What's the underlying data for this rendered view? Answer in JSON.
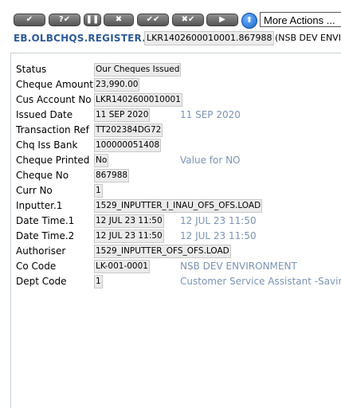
{
  "toolbar": {
    "buttons": [
      {
        "icon": "commit-tick-icon",
        "symbol": "✔"
      },
      {
        "icon": "validate-icon",
        "symbol": "?✔"
      },
      {
        "icon": "hold-icon",
        "symbol": "❚❚"
      },
      {
        "icon": "delete-icon",
        "symbol": "✖"
      },
      {
        "icon": "authorise-icon",
        "symbol": "✔✔"
      },
      {
        "icon": "reverse-icon",
        "symbol": "✖✔"
      },
      {
        "icon": "next-icon",
        "symbol": "▶"
      }
    ],
    "up_symbol": "⬆",
    "more_actions": "More Actions ..."
  },
  "header": {
    "app_title": "EB.OLBCHQS.REGISTER.NSB",
    "record_id": "LKR1402600010001.867988",
    "company": "(NSB DEV ENVI"
  },
  "fields": [
    {
      "label": "Status",
      "value": "Our Cheques Issued",
      "enrichment": ""
    },
    {
      "label": "Cheque Amount",
      "value": "23,990.00",
      "enrichment": ""
    },
    {
      "label": "Cus Account No",
      "value": "LKR1402600010001",
      "enrichment": ""
    },
    {
      "label": "Issued Date",
      "value": "11 SEP 2020",
      "enrichment": "11 SEP 2020"
    },
    {
      "label": "Transaction Ref",
      "value": "TT202384DG72",
      "enrichment": ""
    },
    {
      "label": "Chq Iss Bank",
      "value": "100000051408",
      "enrichment": ""
    },
    {
      "label": "Cheque Printed",
      "value": "No",
      "enrichment": "Value for NO"
    },
    {
      "label": "Cheque No",
      "value": "867988",
      "enrichment": ""
    },
    {
      "label": "Curr No",
      "value": "1",
      "enrichment": ""
    },
    {
      "label": "Inputter.1",
      "value": "1529_INPUTTER_I_INAU_OFS_OFS.LOAD",
      "enrichment": ""
    },
    {
      "label": "Date Time.1",
      "value": "12 JUL 23 11:50",
      "enrichment": "12 JUL 23 11:50"
    },
    {
      "label": "Date Time.2",
      "value": "12 JUL 23 11:50",
      "enrichment": "12 JUL 23 11:50"
    },
    {
      "label": "Authoriser",
      "value": "1529_INPUTTER_OFS_OFS.LOAD",
      "enrichment": ""
    },
    {
      "label": "Co Code",
      "value": "LK-001-0001",
      "enrichment": "NSB DEV ENVIRONMENT"
    },
    {
      "label": "Dept Code",
      "value": "1",
      "enrichment": "Customer Service Assistant -Savings"
    }
  ],
  "colors": {
    "title": "#2e5b9a",
    "enrichment": "#7b93b6",
    "field_bg": "#ebebeb"
  }
}
